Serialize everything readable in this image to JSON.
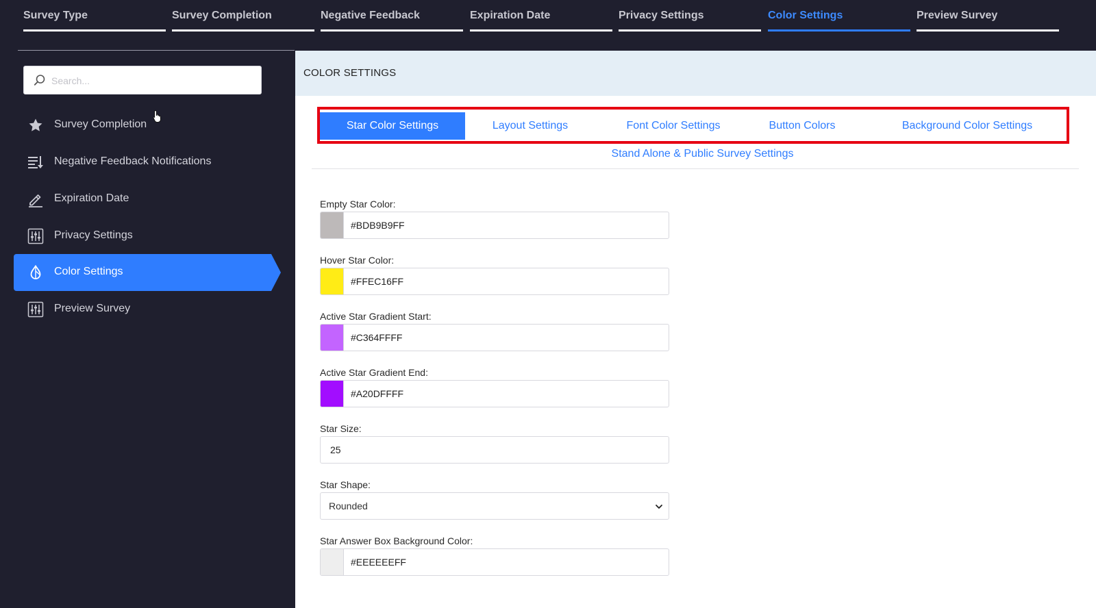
{
  "top_tabs": [
    {
      "label": "Survey Type"
    },
    {
      "label": "Survey Completion"
    },
    {
      "label": "Negative Feedback"
    },
    {
      "label": "Expiration Date"
    },
    {
      "label": "Privacy Settings"
    },
    {
      "label": "Color Settings",
      "active": true
    },
    {
      "label": "Preview Survey"
    }
  ],
  "sidebar": {
    "search_placeholder": "Search...",
    "items": [
      {
        "label": "Survey Completion",
        "icon": "star-icon"
      },
      {
        "label": "Negative Feedback Notifications",
        "icon": "sort-list-icon"
      },
      {
        "label": "Expiration Date",
        "icon": "pencil-icon"
      },
      {
        "label": "Privacy Settings",
        "icon": "sliders-icon"
      },
      {
        "label": "Color Settings",
        "icon": "color-drop-icon",
        "active": true
      },
      {
        "label": "Preview Survey",
        "icon": "sliders-icon"
      }
    ]
  },
  "main": {
    "title": "COLOR SETTINGS",
    "sub_tabs": [
      {
        "label": "Star Color Settings",
        "active": true
      },
      {
        "label": "Layout Settings"
      },
      {
        "label": "Font Color Settings"
      },
      {
        "label": "Button Colors"
      },
      {
        "label": "Background Color Settings"
      }
    ],
    "second_row_tab": "Stand Alone & Public Survey Settings",
    "fields": {
      "empty_star": {
        "label": "Empty Star Color:",
        "value": "#BDB9B9FF",
        "swatch": "#BDB9B9"
      },
      "hover_star": {
        "label": "Hover Star Color:",
        "value": "#FFEC16FF",
        "swatch": "#FFEC16"
      },
      "gradient_start": {
        "label": "Active Star Gradient Start:",
        "value": "#C364FFFF",
        "swatch": "#C364FF"
      },
      "gradient_end": {
        "label": "Active Star Gradient End:",
        "value": "#A20DFFFF",
        "swatch": "#A20DFF"
      },
      "star_size": {
        "label": "Star Size:",
        "value": "25"
      },
      "star_shape": {
        "label": "Star Shape:",
        "value": "Rounded"
      },
      "answer_box_bg": {
        "label": "Star Answer Box Background Color:",
        "value": "#EEEEEEFF",
        "swatch": "#EEEEEE"
      }
    }
  },
  "colors": {
    "accent": "#2F7DFF",
    "sidebar_bg": "#1F1F2E",
    "highlight_border": "#E60012",
    "header_bg": "#E4EEF6"
  }
}
